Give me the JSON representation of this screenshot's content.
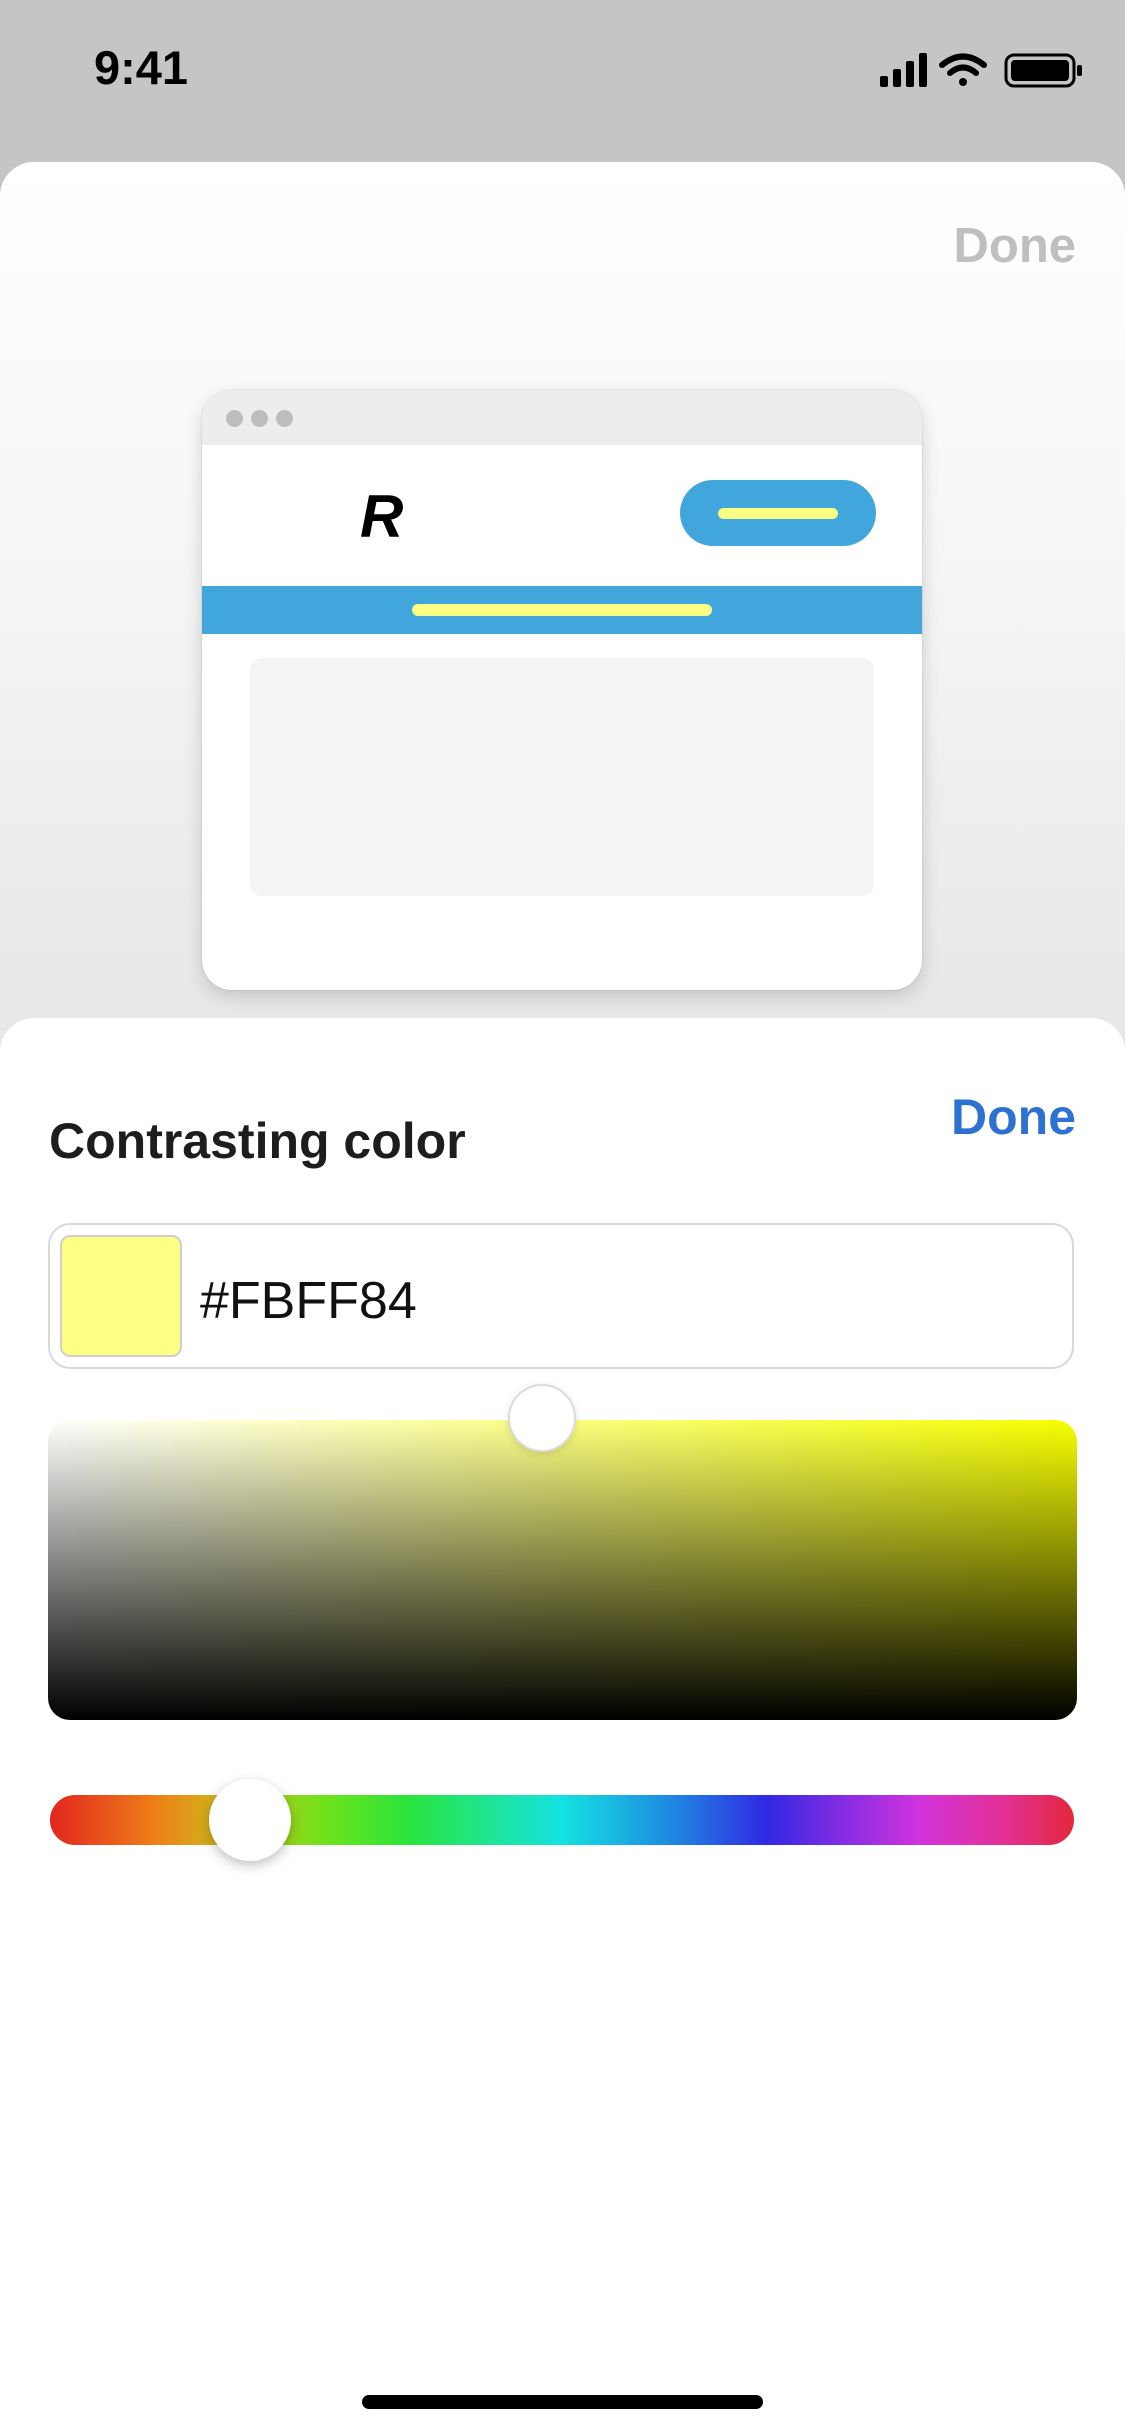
{
  "status_bar": {
    "time": "9:41",
    "icons": [
      "signal-icon",
      "wifi-icon",
      "battery-icon"
    ]
  },
  "preview_sheet": {
    "done_label": "Done",
    "preview": {
      "logo_text": "R",
      "brand_color": "#41a6dc",
      "contrast_color": "#fbff84"
    }
  },
  "color_sheet": {
    "title": "Contrasting color",
    "done_label": "Done",
    "hex_value": "#FBFF84",
    "swatch_color": "#FBFF84",
    "saturation": 0.48,
    "brightness": 1.0,
    "hue_degrees": 62,
    "hue_fraction": 0.195,
    "accent_color": "#2d72d2"
  }
}
